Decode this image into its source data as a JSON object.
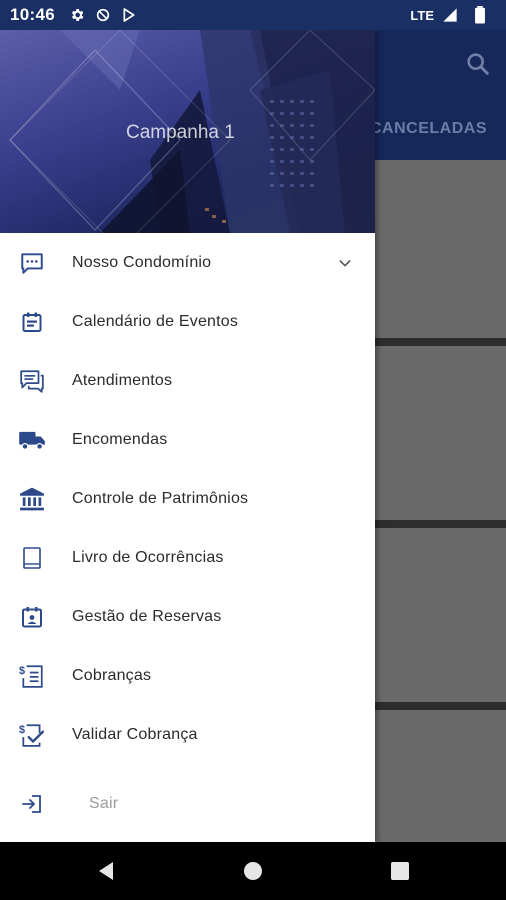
{
  "status_bar": {
    "time": "10:46",
    "network": "LTE",
    "icons": [
      "gear-icon",
      "sync-icon",
      "play-store-icon",
      "signal-icon",
      "battery-icon"
    ]
  },
  "app": {
    "tab_label": "CANCELADAS",
    "header_color": "#16285a"
  },
  "drawer": {
    "campaign_title": "Campanha 1",
    "items": [
      {
        "label": "Nosso Condomínio",
        "icon": "chat-icon",
        "expandable": true
      },
      {
        "label": "Calendário de Eventos",
        "icon": "calendar-icon"
      },
      {
        "label": "Atendimentos",
        "icon": "messages-icon"
      },
      {
        "label": "Encomendas",
        "icon": "truck-icon"
      },
      {
        "label": "Controle de Patrimônios",
        "icon": "bank-icon"
      },
      {
        "label": "Livro de Ocorrências",
        "icon": "book-icon"
      },
      {
        "label": "Gestão de Reservas",
        "icon": "calendar-person-icon"
      },
      {
        "label": "Cobranças",
        "icon": "invoice-icon"
      },
      {
        "label": "Validar Cobrança",
        "icon": "invoice-check-icon"
      }
    ],
    "logout_label": "Sair",
    "logout_icon": "logout-icon"
  },
  "colors": {
    "accent": "#2c4a8a",
    "status_bar": "#1a2f63"
  }
}
